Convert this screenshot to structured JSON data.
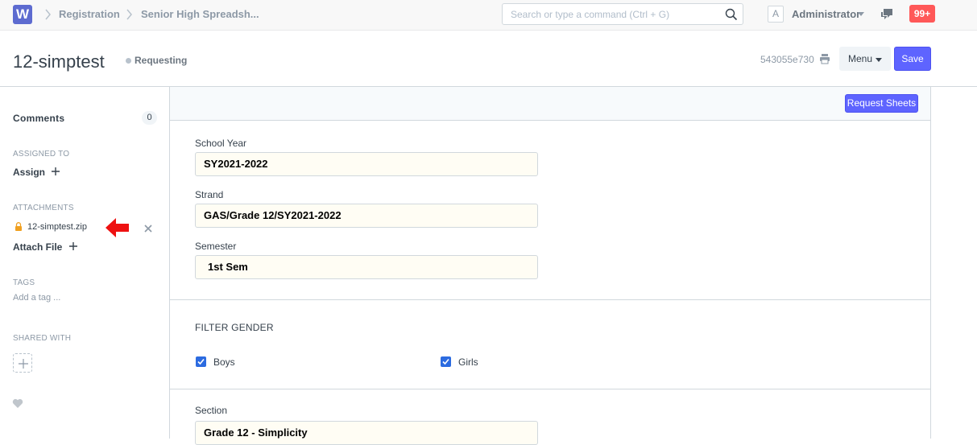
{
  "navbar": {
    "logo_letter": "W",
    "breadcrumbs": [
      "Registration",
      "Senior High Spreadsh..."
    ],
    "search_placeholder": "Search or type a command (Ctrl + G)",
    "avatar_letter": "A",
    "user_name": "Administrator",
    "notification_count": "99+"
  },
  "page_head": {
    "title": "12-simptest",
    "status": "Requesting",
    "doc_id": "543055e730",
    "menu_label": "Menu",
    "save_label": "Save"
  },
  "sidebar": {
    "comments_label": "Comments",
    "comments_count": "0",
    "assigned_to_label": "ASSIGNED TO",
    "assign_label": "Assign",
    "attachments_label": "ATTACHMENTS",
    "attachment_name": "12-simptest.zip",
    "attach_file_label": "Attach File",
    "tags_label": "TAGS",
    "tag_placeholder": "Add a tag ...",
    "shared_with_label": "SHARED WITH"
  },
  "form": {
    "request_button": "Request Sheets",
    "fields": {
      "school_year_label": "School Year",
      "school_year_value": "SY2021-2022",
      "strand_label": "Strand",
      "strand_value": "GAS/Grade 12/SY2021-2022",
      "semester_label": "Semester",
      "semester_value": "1st Sem"
    },
    "filter_gender": {
      "heading": "FILTER GENDER",
      "boys_label": "Boys",
      "boys_checked": true,
      "girls_label": "Girls",
      "girls_checked": true
    },
    "section_field": {
      "label": "Section",
      "value": "Grade 12 - Simplicity"
    }
  },
  "colors": {
    "primary": "#5e64ff",
    "notification": "#ff5858",
    "arrow": "#ee1111",
    "logo": "#5d6bd0",
    "lock": "#f0a020",
    "checkbox": "#2c6be0"
  }
}
